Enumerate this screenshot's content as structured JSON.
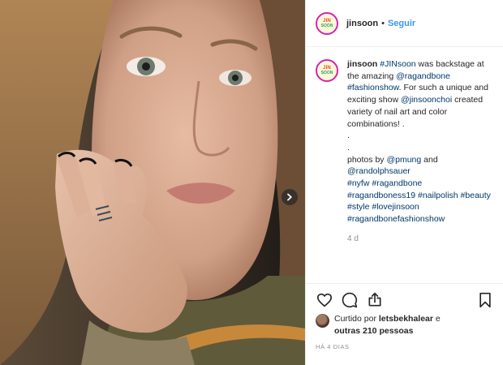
{
  "header": {
    "username": "jinsoon",
    "separator": "•",
    "follow_label": "Seguir",
    "logo_top": "JIN",
    "logo_bottom": "SOON"
  },
  "caption": {
    "username": "jinsoon",
    "line1_tag": "#JINsoon",
    "line1_text": " was backstage at the amazing ",
    "mention1": "@ragandbone",
    "tag_fashionshow": "#fashionshow",
    "text2": ". For such a unique and exciting show ",
    "mention2": "@jinsoonchoi",
    "text3": " created variety of nail art and color combinations! .",
    "dot1": ".",
    "dot2": ".",
    "photos_by": "photos by ",
    "mention3": "@pmung",
    "and": " and",
    "mention4": "@randolphsauer",
    "tag_nyfw": "#nyfw",
    "tag_ragandbone": "#ragandbone",
    "tag_ragandboness19": "#ragandboness19",
    "tag_nailpolish": "#nailpolish",
    "tag_beauty": "#beauty",
    "tag_style": "#style",
    "tag_lovejinsoon": "#lovejinsoon",
    "tag_ragandbonefashionshow": "#ragandbonefashionshow",
    "time_ago": "4 d"
  },
  "actions": {
    "like_icon": "heart-icon",
    "comment_icon": "comment-icon",
    "share_icon": "share-icon",
    "save_icon": "bookmark-icon"
  },
  "likes": {
    "prefix": "Curtido por ",
    "user": "letsbekhalear",
    "mid": " e",
    "others": "outras 210 pessoas"
  },
  "date_label": "HÁ 4 DIAS"
}
